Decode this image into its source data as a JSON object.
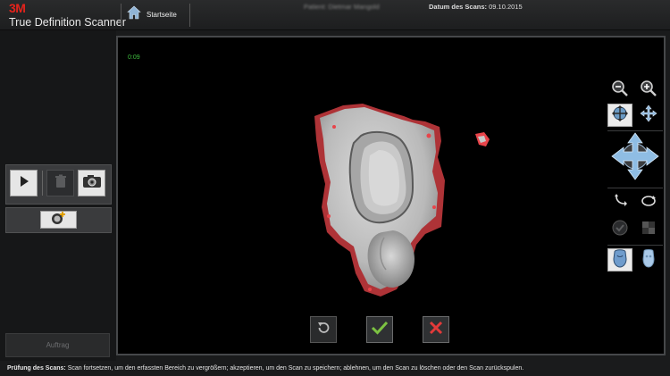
{
  "header": {
    "brand_logo": "3M",
    "brand_name": "True Definition Scanner",
    "home_label": "Startseite",
    "patient_label": "Patient:",
    "patient_value": "Dietmar Mangold",
    "date_label": "Datum des Scans:",
    "date_value": "09.10.2015"
  },
  "left_panel": {
    "order_button_label": "Auftrag"
  },
  "viewport": {
    "timer": "0:09"
  },
  "status_bar": {
    "label": "Prüfung des Scans:",
    "text": "Scan fortsetzen, um den erfassten Bereich zu vergrößern; akzeptieren, um den Scan zu speichern; ablehnen, um den Scan zu löschen oder den Scan zurückspulen."
  },
  "colors": {
    "brand_red": "#e4231b",
    "timer_green": "#3fbf3f",
    "accept_green": "#7cc242",
    "reject_red": "#e23a3a",
    "scan_highlight_red": "#e8444a"
  },
  "icons": {
    "home": "home-icon",
    "play": "play-icon",
    "trash": "trash-icon",
    "camera": "camera-icon",
    "add_scan": "add-scan-icon",
    "zoom_out": "zoom-out-icon",
    "zoom_in": "zoom-in-icon",
    "rotate_mode": "rotate-mode-icon",
    "pan_mode": "pan-mode-icon",
    "view_navigator": "view-navigator-icon",
    "reset_view": "reset-view-icon",
    "rotate_180": "rotate-180-icon",
    "check_ghost": "check-ghost-icon",
    "texture_toggle": "texture-toggle-icon",
    "stone_model": "stone-model-icon",
    "tooth_model": "tooth-model-icon",
    "undo": "undo-icon",
    "accept": "checkmark-icon",
    "reject": "close-icon"
  }
}
